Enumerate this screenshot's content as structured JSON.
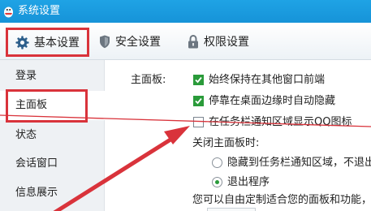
{
  "window": {
    "title": "系统设置"
  },
  "tabs": [
    {
      "label": "基本设置",
      "icon": "gear-icon"
    },
    {
      "label": "安全设置",
      "icon": "shield-icon"
    },
    {
      "label": "权限设置",
      "icon": "lock-icon"
    }
  ],
  "sidebar": {
    "items": [
      "登录",
      "主面板",
      "状态",
      "会话窗口",
      "信息展示"
    ]
  },
  "main": {
    "section_label": "主面板:",
    "options": [
      {
        "label": "始终保持在其他窗口前端",
        "checked": true
      },
      {
        "label": "停靠在桌面边缘时自动隐藏",
        "checked": true
      },
      {
        "label": "在任务栏通知区域显示QQ图标",
        "checked": false
      }
    ],
    "close_label": "关闭主面板时:",
    "close_options": [
      {
        "label": "隐藏到任务栏通知区域，不退出程",
        "selected": false
      },
      {
        "label": "退出程序",
        "selected": true
      }
    ],
    "note": "您可以自由定制适合您的面板和功能，使"
  },
  "colors": {
    "title_bar": "#1693d8",
    "highlight": "#d9333b",
    "check": "#2a9b3a"
  }
}
